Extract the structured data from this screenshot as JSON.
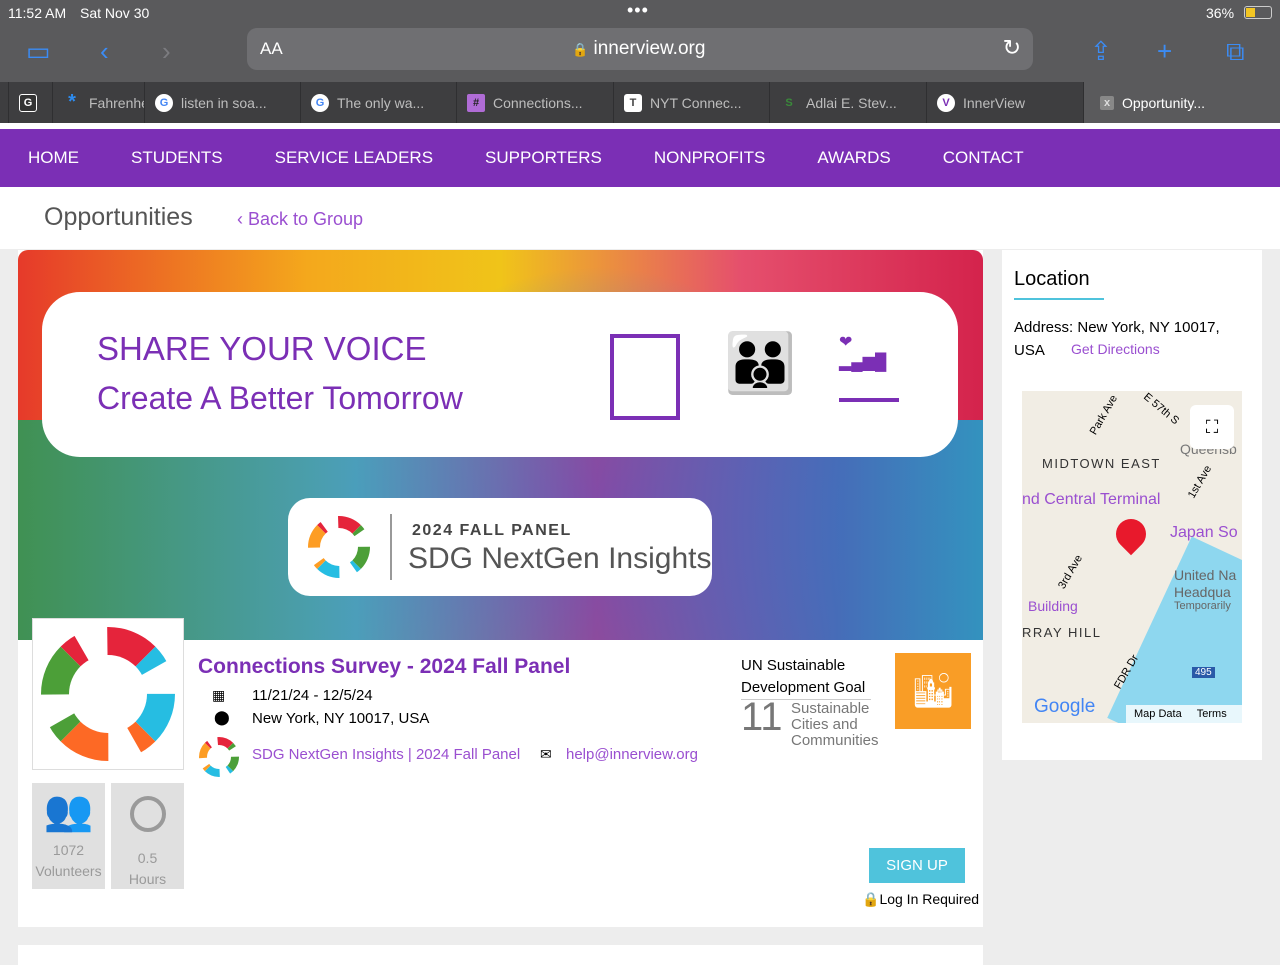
{
  "status": {
    "time": "11:52 AM",
    "date": "Sat Nov 30",
    "battery": "36%"
  },
  "browser": {
    "reader": "AA",
    "url": "innerview.org"
  },
  "tabs": [
    {
      "label": "",
      "icon": "G"
    },
    {
      "label": "Fahrenheit",
      "icon": "*"
    },
    {
      "label": "listen in soa...",
      "icon": "G"
    },
    {
      "label": "The only wa...",
      "icon": "G"
    },
    {
      "label": "Connections...",
      "icon": "#"
    },
    {
      "label": "NYT Connec...",
      "icon": "T"
    },
    {
      "label": "Adlai E. Stev...",
      "icon": "S"
    },
    {
      "label": "InnerView",
      "icon": "V"
    },
    {
      "label": "Opportunity...",
      "icon": "x"
    }
  ],
  "nav": [
    "HOME",
    "STUDENTS",
    "SERVICE LEADERS",
    "SUPPORTERS",
    "NONPROFITS",
    "AWARDS",
    "CONTACT"
  ],
  "page": {
    "title": "Opportunities",
    "back": "Back to Group"
  },
  "banner": {
    "line1": "SHARE YOUR VOICE",
    "line2": "Create A Better Tomorrow",
    "panel_small": "2024 FALL PANEL",
    "panel_big": "SDG NextGen Insights"
  },
  "event": {
    "title": "Connections Survey - 2024 Fall Panel",
    "dates": "11/21/24 - 12/5/24",
    "location": "New York, NY 10017, USA",
    "group": "SDG NextGen Insights | 2024 Fall Panel",
    "email": "help@innerview.org"
  },
  "sdg": {
    "label": "UN Sustainable Development Goal",
    "number": "11",
    "name": "Sustainable Cities and Communities",
    "color": "#f99d26"
  },
  "stats": {
    "volunteers": "1072",
    "volunteers_label": "Volunteers",
    "hours": "0.5",
    "hours_label": "Hours"
  },
  "actions": {
    "signup": "SIGN UP",
    "login": "Log In Required"
  },
  "location": {
    "heading": "Location",
    "address": "Address: New York, NY 10017, USA",
    "directions": "Get Directions"
  },
  "map": {
    "midtown": "MIDTOWN EAST",
    "terminal": "nd Central Terminal",
    "japan": "Japan So",
    "un": "United Na",
    "hq": "Headqua",
    "temp": "Temporarily",
    "building": "Building",
    "murray": "RRAY HILL",
    "park": "Park Ave",
    "e57": "E 57th S",
    "queens": "Queensb",
    "first": "1st Ave",
    "third": "3rd Ave",
    "fdr": "FDR Dr",
    "route": "495",
    "google": "Google",
    "mapdata": "Map Data",
    "terms": "Terms"
  }
}
